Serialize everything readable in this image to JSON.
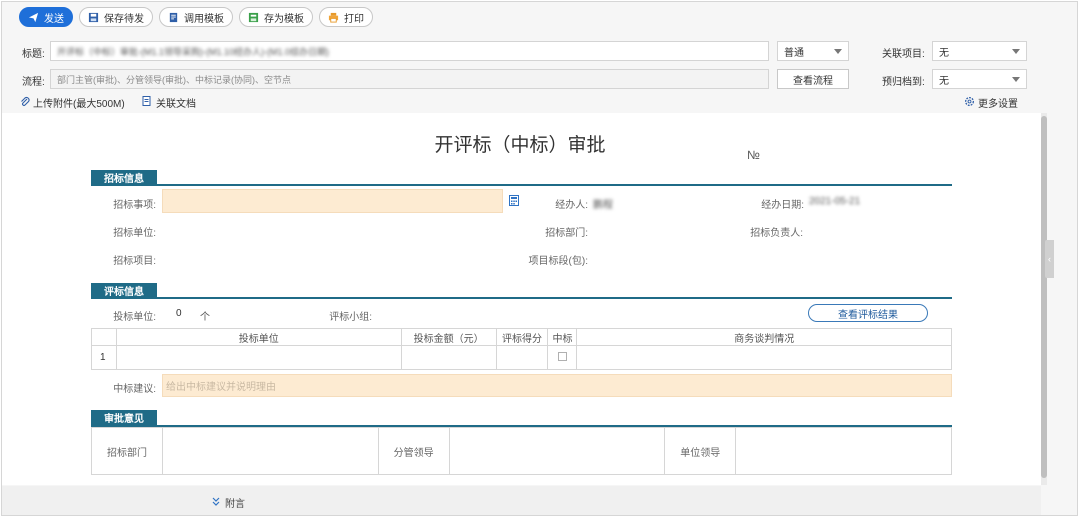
{
  "toolbar": {
    "send": "发送",
    "save_pending": "保存待发",
    "use_template": "调用模板",
    "save_as_template": "存为模板",
    "print": "打印"
  },
  "header": {
    "subject_label": "标题:",
    "subject_value": "开评标（中标）审批-(M1.1领导采购)-(M1.10经办人)-(M1.0综办日期)",
    "priority_value": "普通",
    "related_project_label": "关联项目:",
    "related_project_value": "无",
    "flow_label": "流程:",
    "flow_value": "部门主管(审批)、分管领导(审批)、中标记录(协同)、空节点",
    "view_flow": "查看流程",
    "archive_label": "预归档到:",
    "archive_value": "无",
    "upload": "上传附件(最大500M)",
    "related_doc": "关联文档",
    "more_settings": "更多设置"
  },
  "form": {
    "title": "开评标（中标）审批",
    "number_label": "№",
    "section_bid": "招标信息",
    "bid_item_label": "招标事项:",
    "handler_label": "经办人:",
    "handler_value": "鹏程",
    "handle_date_label": "经办日期:",
    "handle_date_value": "2021-05-21",
    "bid_unit_label": "招标单位:",
    "bid_dept_label": "招标部门:",
    "bid_owner_label": "招标负责人:",
    "bid_project_label": "招标项目:",
    "project_lot_label": "项目标段(包):",
    "section_eval": "评标信息",
    "bidder_count_label": "投标单位:",
    "bidder_count_value": "0",
    "bidder_count_unit": "个",
    "eval_group_label": "评标小组:",
    "view_eval_results": "查看评标结果",
    "table_headers": [
      "投标单位",
      "投标金额（元）",
      "评标得分",
      "中标",
      "商务谈判情况"
    ],
    "table_rows": [
      {
        "index": "1",
        "bidder": "",
        "amount": "",
        "score": "",
        "note": ""
      }
    ],
    "award_label": "中标建议:",
    "award_placeholder": "给出中标建议并说明理由",
    "section_approval": "审批意见",
    "approval_dept": "招标部门",
    "approval_leader": "分管领导",
    "approval_unit_leader": "单位领导"
  },
  "footer": {
    "attachment_link": "附言"
  },
  "colors": {
    "primary": "#1e6fd9",
    "section": "#1f6b87",
    "highlight_input": "#fdebd2"
  }
}
